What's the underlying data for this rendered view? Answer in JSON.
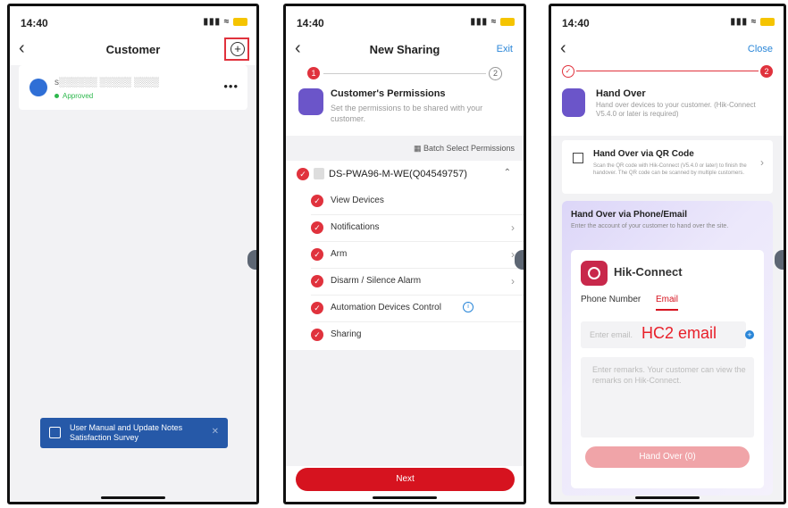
{
  "p1": {
    "time": "14:40",
    "title": "Customer",
    "customer_name": "s░░░░░░ ░░░░░ ░░░░",
    "status": "Approved",
    "more": "•••",
    "banner_line1": "User Manual and Update Notes",
    "banner_line2": "Satisfaction Survey",
    "banner_close": "✕"
  },
  "p2": {
    "time": "14:40",
    "title": "New Sharing",
    "exit": "Exit",
    "step1": "1",
    "step2": "2",
    "section_title": "Customer's Permissions",
    "section_sub": "Set the permissions to be shared with your customer.",
    "batch": "Batch Select Permissions",
    "device": "DS-PWA96-M-WE(Q04549757)",
    "permissions": [
      "View Devices",
      "Notifications",
      "Arm",
      "Disarm / Silence Alarm",
      "Automation Devices Control",
      "Sharing"
    ],
    "next": "Next"
  },
  "p3": {
    "time": "14:40",
    "close": "Close",
    "step2": "2",
    "title": "Hand Over",
    "sub": "Hand over devices to your customer. (Hik-Connect V5.4.0 or later is required)",
    "qr_title": "Hand Over via QR Code",
    "qr_sub": "Scan the QR code with Hik-Connect (V5.4.0 or later) to finish the handover. The QR code can be scanned by multiple customers.",
    "phone_title": "Hand Over via Phone/Email",
    "phone_sub": "Enter the account of your customer to hand over the site.",
    "brand": "Hik-Connect",
    "tab_phone": "Phone Number",
    "tab_email": "Email",
    "email_placeholder": "Enter email.",
    "email_annotation": "HC2 email",
    "remarks_placeholder": "Enter remarks. Your customer can view the remarks on Hik-Connect.",
    "handover_btn": "Hand Over (0)"
  }
}
